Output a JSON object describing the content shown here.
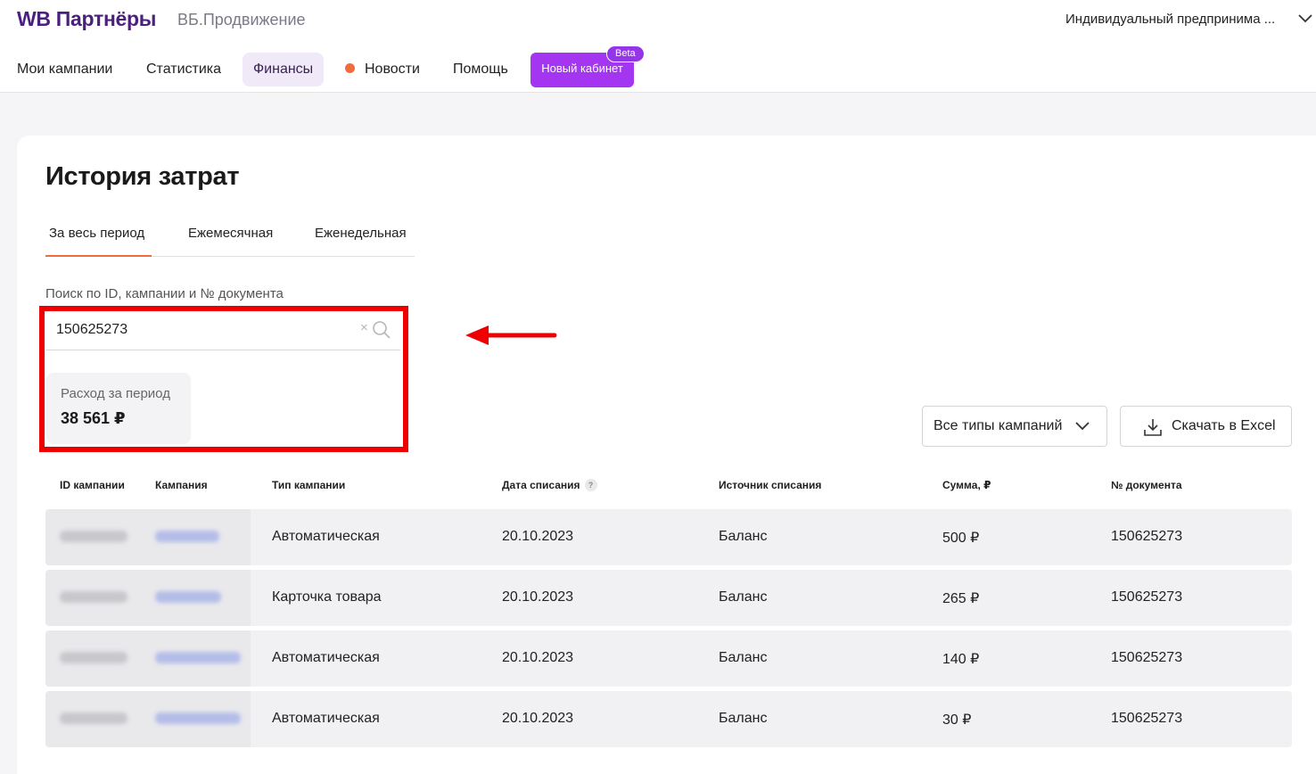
{
  "header": {
    "logo": "WB Партнёры",
    "subtitle": "ВБ.Продвижение",
    "account": "Индивидуальный предпринима ..."
  },
  "nav": {
    "campaigns": "Мои кампании",
    "stats": "Статистика",
    "finance": "Финансы",
    "news": "Новости",
    "help": "Помощь",
    "new_cabinet": "Новый кабинет",
    "beta": "Beta"
  },
  "page": {
    "title": "История затрат",
    "tabs": [
      "За весь период",
      "Ежемесячная",
      "Еженедельная"
    ],
    "active_tab": 0
  },
  "search": {
    "label": "Поиск по ID, кампании и № документа",
    "value": "150625273"
  },
  "spend": {
    "label": "Расход за период",
    "value": "38 561 ₽"
  },
  "filters": {
    "campaign_types": "Все типы кампаний",
    "download": "Скачать в Excel"
  },
  "table": {
    "headers": [
      "ID кампании",
      "Кампания",
      "Тип кампании",
      "Дата списания",
      "Источник списания",
      "Сумма, ₽",
      "№ документа"
    ],
    "rows": [
      {
        "type": "Автоматическая",
        "date": "20.10.2023",
        "source": "Баланс",
        "amount": "500 ₽",
        "doc": "150625273"
      },
      {
        "type": "Карточка товара",
        "date": "20.10.2023",
        "source": "Баланс",
        "amount": "265 ₽",
        "doc": "150625273"
      },
      {
        "type": "Автоматическая",
        "date": "20.10.2023",
        "source": "Баланс",
        "amount": "140 ₽",
        "doc": "150625273"
      },
      {
        "type": "Автоматическая",
        "date": "20.10.2023",
        "source": "Баланс",
        "amount": "30 ₽",
        "doc": "150625273"
      }
    ]
  },
  "colors": {
    "brand": "#4b1f80",
    "accent": "#a435f0",
    "tab_underline": "#f26b3a",
    "highlight": "#ee0000"
  }
}
